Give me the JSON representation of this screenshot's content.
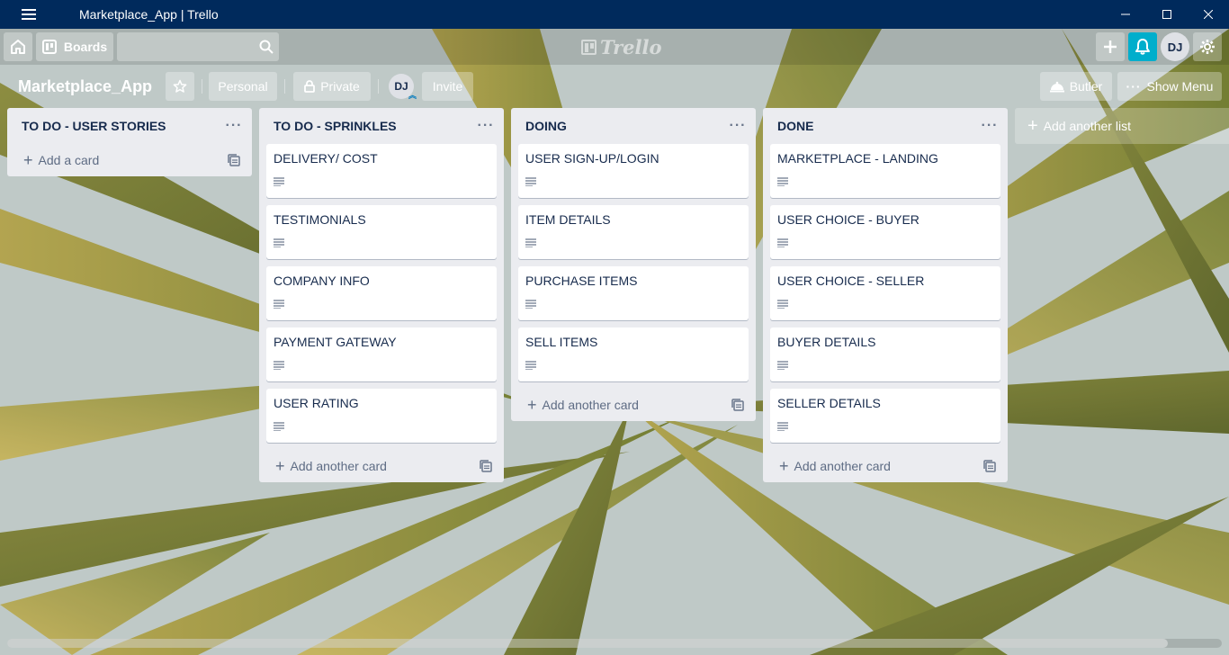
{
  "window": {
    "title": "Marketplace_App | Trello",
    "controls": [
      "minimize",
      "maximize",
      "close"
    ]
  },
  "header": {
    "boards_label": "Boards",
    "search_placeholder": "",
    "logo_text": "Trello",
    "user_initials": "DJ",
    "notification_color": "#00aecc"
  },
  "board": {
    "title": "Marketplace_App",
    "team_label": "Personal",
    "visibility_label": "Private",
    "member_initials": "DJ",
    "invite_label": "Invite",
    "butler_label": "Butler",
    "menu_label": "Show Menu"
  },
  "lists": [
    {
      "title": "TO DO - USER STORIES",
      "cards": [],
      "add_label": "Add a card"
    },
    {
      "title": "TO DO - SPRINKLES",
      "cards": [
        "DELIVERY/ COST",
        "TESTIMONIALS",
        "COMPANY INFO",
        "PAYMENT GATEWAY",
        "USER RATING"
      ],
      "add_label": "Add another card"
    },
    {
      "title": "DOING",
      "cards": [
        "USER SIGN-UP/LOGIN",
        "ITEM DETAILS",
        "PURCHASE ITEMS",
        "SELL ITEMS"
      ],
      "add_label": "Add another card"
    },
    {
      "title": "DONE",
      "cards": [
        "MARKETPLACE - LANDING",
        "USER CHOICE - BUYER",
        "USER CHOICE - SELLER",
        "BUYER DETAILS",
        "SELLER DETAILS"
      ],
      "add_label": "Add another card"
    }
  ],
  "add_list_label": "Add another list",
  "colors": {
    "titlebar": "#002a5c",
    "list_bg": "#ebecf0",
    "card_text": "#172b4d",
    "muted_text": "#5e6c84"
  }
}
